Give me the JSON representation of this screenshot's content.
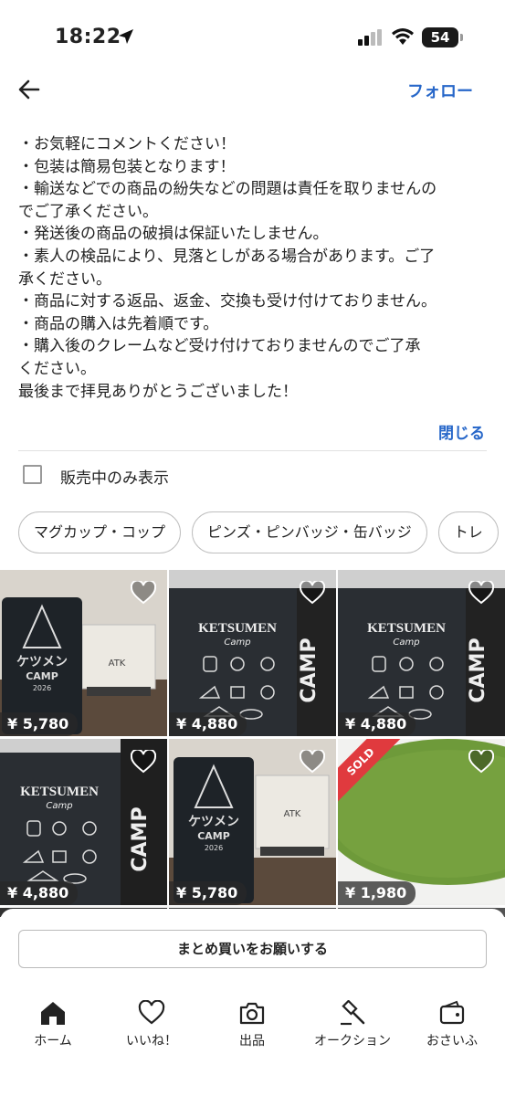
{
  "status_bar": {
    "time": "18:22",
    "battery": "54"
  },
  "header": {
    "follow_label": "フォロー"
  },
  "description": {
    "lines": [
      "・お気軽にコメントください！",
      "・包装は簡易包装となります！",
      "・輸送などでの商品の紛失などの問題は責任を取りませんの",
      "でご了承ください。",
      "・発送後の商品の破損は保証いたしません。",
      "・素人の検品により、見落としがある場合があります。ご了",
      "承ください。",
      "・商品に対する返品、返金、交換も受け付けておりません。",
      "・商品の購入は先着順です。",
      "・購入後のクレームなど受け付けておりませんのでご了承",
      "ください。",
      "最後まで拝見ありがとうございました！"
    ],
    "close_label": "閉じる"
  },
  "filter": {
    "label": "販売中のみ表示"
  },
  "chips": [
    "マグカップ・コップ",
    "ピンズ・ピンバッジ・缶バッジ",
    "トレ"
  ],
  "products": [
    {
      "price": "¥ 5,780",
      "sold": false
    },
    {
      "price": "¥ 4,880",
      "sold": false
    },
    {
      "price": "¥ 4,880",
      "sold": false
    },
    {
      "price": "¥ 4,880",
      "sold": false
    },
    {
      "price": "¥ 5,780",
      "sold": false
    },
    {
      "price": "¥ 1,980",
      "sold": true,
      "sold_label": "SOLD"
    }
  ],
  "product_art": {
    "brand": "KETSUMEN",
    "sub": "Camp",
    "mug_text": "ケツメン",
    "mug_camp": "CAMP",
    "mug_year": "2026",
    "box_text": "ATK",
    "roll_text": "CAMP"
  },
  "bottom_sheet": {
    "bulk_label": "まとめ買いをお願いする"
  },
  "tabs": [
    {
      "label": "ホーム",
      "icon": "home-icon",
      "active": true
    },
    {
      "label": "いいね！",
      "icon": "heart-icon"
    },
    {
      "label": "出品",
      "icon": "camera-icon"
    },
    {
      "label": "オークション",
      "icon": "gavel-icon"
    },
    {
      "label": "おさいふ",
      "icon": "wallet-icon"
    }
  ],
  "colors": {
    "accent": "#2767c9",
    "sold": "#e03a3e"
  }
}
